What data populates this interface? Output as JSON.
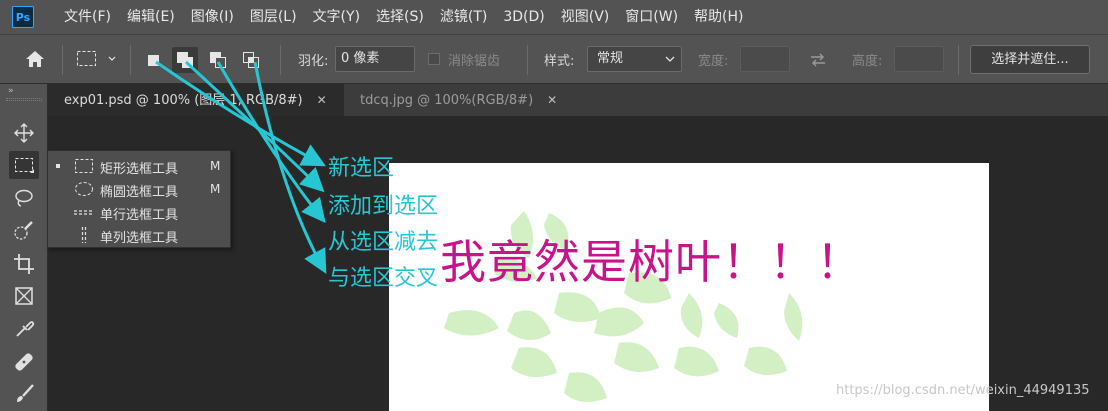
{
  "app": {
    "logo_text": "Ps",
    "menu": [
      "文件(F)",
      "编辑(E)",
      "图像(I)",
      "图层(L)",
      "文字(Y)",
      "选择(S)",
      "滤镜(T)",
      "3D(D)",
      "视图(V)",
      "窗口(W)",
      "帮助(H)"
    ]
  },
  "options": {
    "feather_label": "羽化:",
    "feather_value": "0 像素",
    "antialias_label": "消除锯齿",
    "style_label": "样式:",
    "style_value": "常规",
    "width_label": "宽度:",
    "height_label": "高度:",
    "select_mask_button": "选择并遮住..."
  },
  "tabs": [
    {
      "label": "exp01.psd @ 100% (图层 1, RGB/8#)",
      "close": "✕"
    },
    {
      "label": "tdcq.jpg @ 100%(RGB/8#)",
      "close": "✕"
    }
  ],
  "flyout": {
    "items": [
      {
        "label": "矩形选框工具",
        "key": "M"
      },
      {
        "label": "椭圆选框工具",
        "key": "M"
      },
      {
        "label": "单行选框工具",
        "key": ""
      },
      {
        "label": "单列选框工具",
        "key": ""
      }
    ]
  },
  "annotations": [
    "新选区",
    "添加到选区",
    "从选区减去",
    "与选区交叉"
  ],
  "canvas": {
    "title_text": "我竟然是树叶！！！"
  },
  "watermark": "https://blog.csdn.net/weixin_44949135",
  "colors": {
    "annotation": "#27c6d3",
    "title": "#c9138a",
    "leaf": "#d2f0c4"
  }
}
